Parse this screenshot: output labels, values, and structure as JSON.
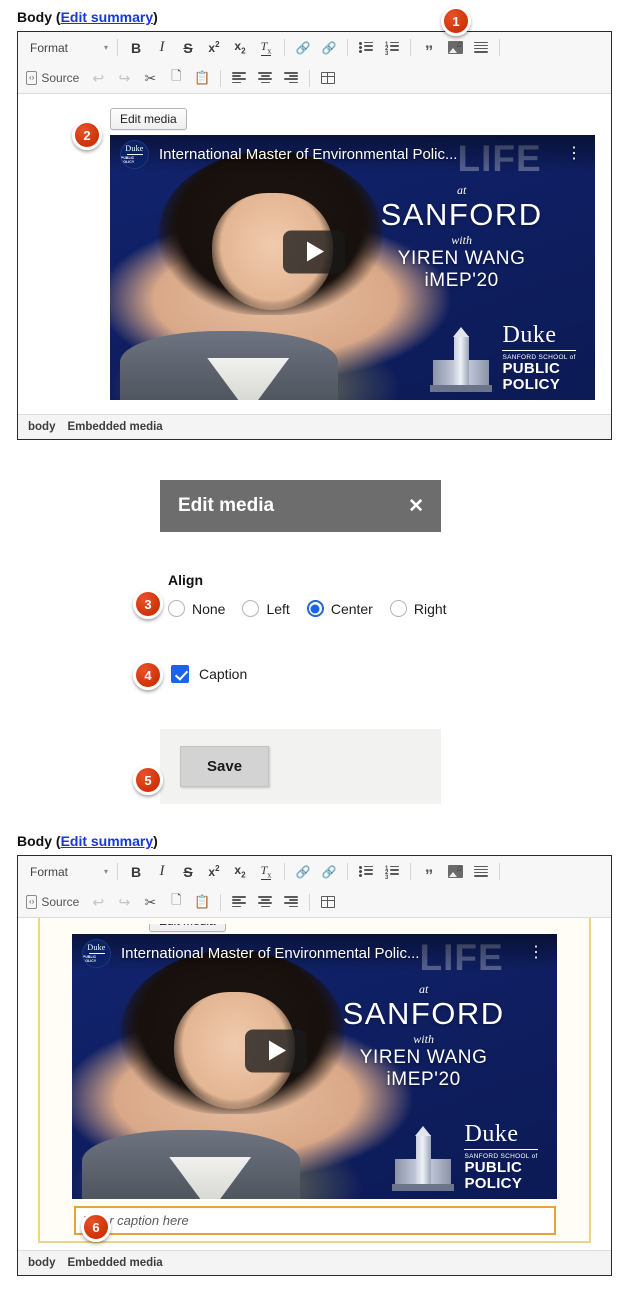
{
  "section_top": {
    "label_prefix": "Body (",
    "link_text": "Edit summary",
    "label_suffix": ")"
  },
  "toolbar": {
    "format_label": "Format",
    "format_caret": "▾",
    "source_label": "Source",
    "source_icon": "‹›",
    "buttons_row1": [
      {
        "name": "bold-button",
        "glyph": "B"
      },
      {
        "name": "italic-button",
        "glyph": "I"
      },
      {
        "name": "strikethrough-button",
        "glyph": "S"
      },
      {
        "name": "superscript-button",
        "glyph": "x"
      },
      {
        "name": "subscript-button",
        "glyph": "x"
      },
      {
        "name": "remove-format-button",
        "glyph": "I"
      }
    ],
    "link_glyph": "⚭",
    "unlink_glyph": "⚮",
    "blockquote_glyph": "”",
    "list_numbers": [
      "1",
      "2",
      "3"
    ]
  },
  "edit_media_button": {
    "label": "Edit media"
  },
  "video": {
    "title": "International Master of Environmental Polic...",
    "kebab": "⋮",
    "avatar_word": "Duke",
    "avatar_sub1": "SANFORD SCHOOL of",
    "avatar_sub2": "PUBLIC POLICY",
    "watermark": "LIFE",
    "overlay_at": "at",
    "overlay_school": "SANFORD",
    "overlay_with": "with",
    "overlay_name": "YIREN WANG",
    "overlay_year": "iMEP'20",
    "logo_word": "Duke",
    "logo_sub1": "SANFORD SCHOOL of",
    "logo_sub2": "PUBLIC",
    "logo_sub3": "POLICY"
  },
  "breadcrumb": {
    "root": "body",
    "current": "Embedded media"
  },
  "dialog": {
    "title": "Edit media",
    "close_glyph": "✕",
    "align_label": "Align",
    "align_options": [
      {
        "label": "None",
        "checked": false
      },
      {
        "label": "Left",
        "checked": false
      },
      {
        "label": "Center",
        "checked": true
      },
      {
        "label": "Right",
        "checked": false
      }
    ],
    "caption_label": "Caption",
    "caption_checked": true,
    "save_label": "Save"
  },
  "section_bottom": {
    "label_prefix": "Body (",
    "link_text": "Edit summary",
    "label_suffix": ")"
  },
  "caption_field": {
    "value": "",
    "placeholder": "Enter caption here"
  },
  "callouts": [
    {
      "number": "1"
    },
    {
      "number": "2"
    },
    {
      "number": "3"
    },
    {
      "number": "4"
    },
    {
      "number": "5"
    },
    {
      "number": "6"
    }
  ],
  "colors": {
    "badge": "#cf3206",
    "link": "#1a37d6",
    "accent_blue": "#1b63e8",
    "selection_border": "#e8a33d",
    "dialog_header": "#6d6d6d",
    "video_bg": "#10216b"
  }
}
